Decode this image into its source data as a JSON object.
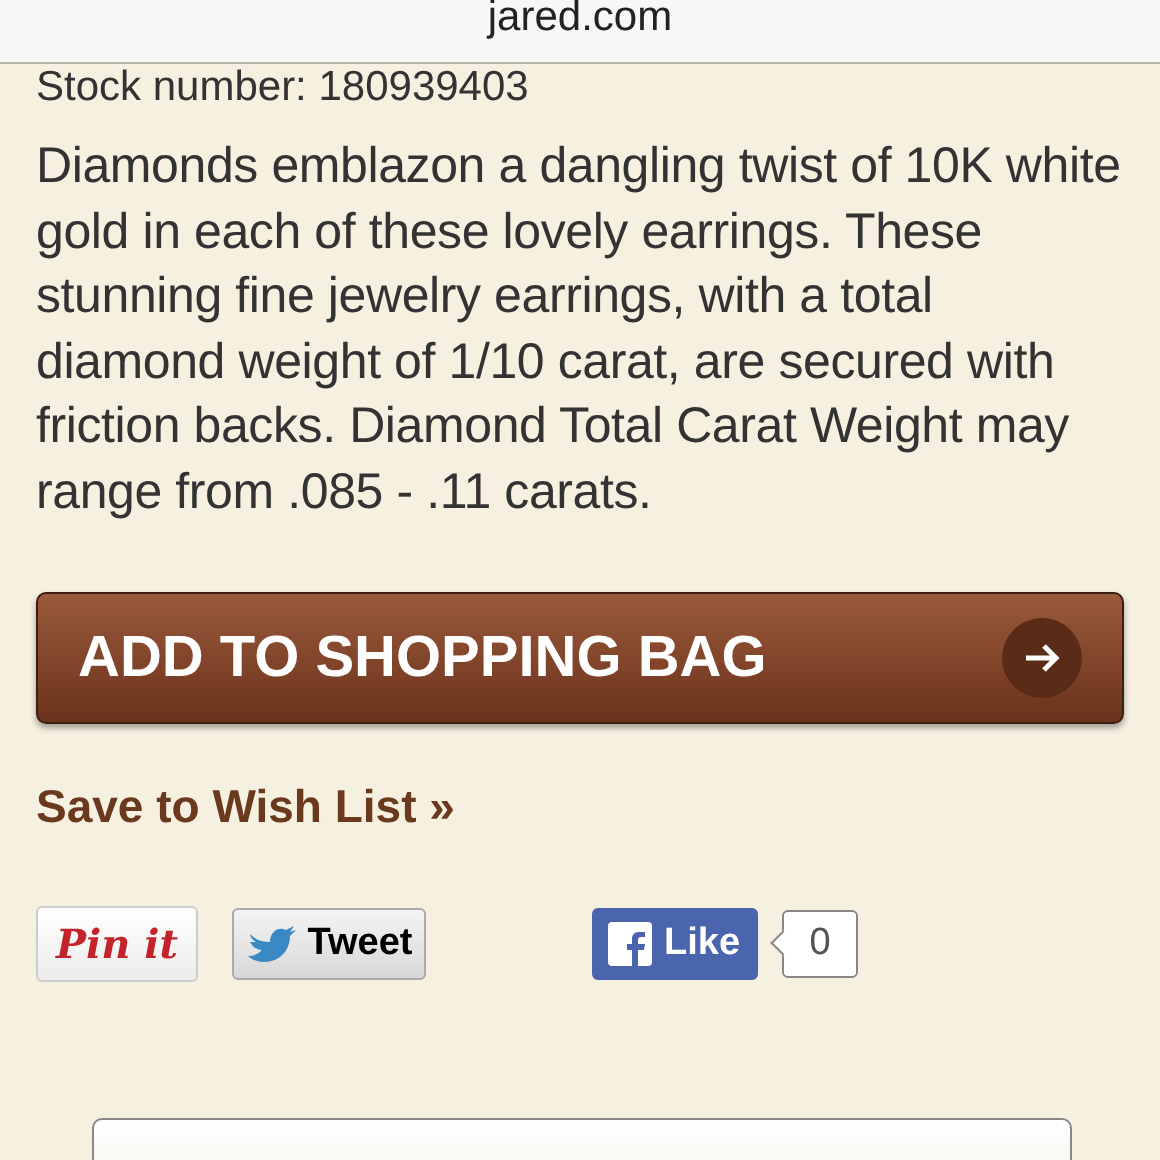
{
  "browser_bar": {
    "address": "jared.com"
  },
  "stock_number": "Stock number: 180939403",
  "description": "Diamonds emblazon a dangling twist of 10K white gold in each of these lovely earrings. These stunning fine jewelry earrings, with a total diamond weight of 1/10 carat, are secured with friction backs. Diamond Total Carat Weight may range from .085 - .11 carats.",
  "add_to_bag": {
    "label": "ADD TO SHOPPING BAG"
  },
  "wish_list": "Save to Wish List »",
  "social": [
    {
      "kind": "pinterest",
      "label": "Pin it"
    },
    {
      "kind": "twitter",
      "label": "Tweet"
    },
    {
      "kind": "facebook",
      "label": "Like",
      "count": "0"
    }
  ]
}
